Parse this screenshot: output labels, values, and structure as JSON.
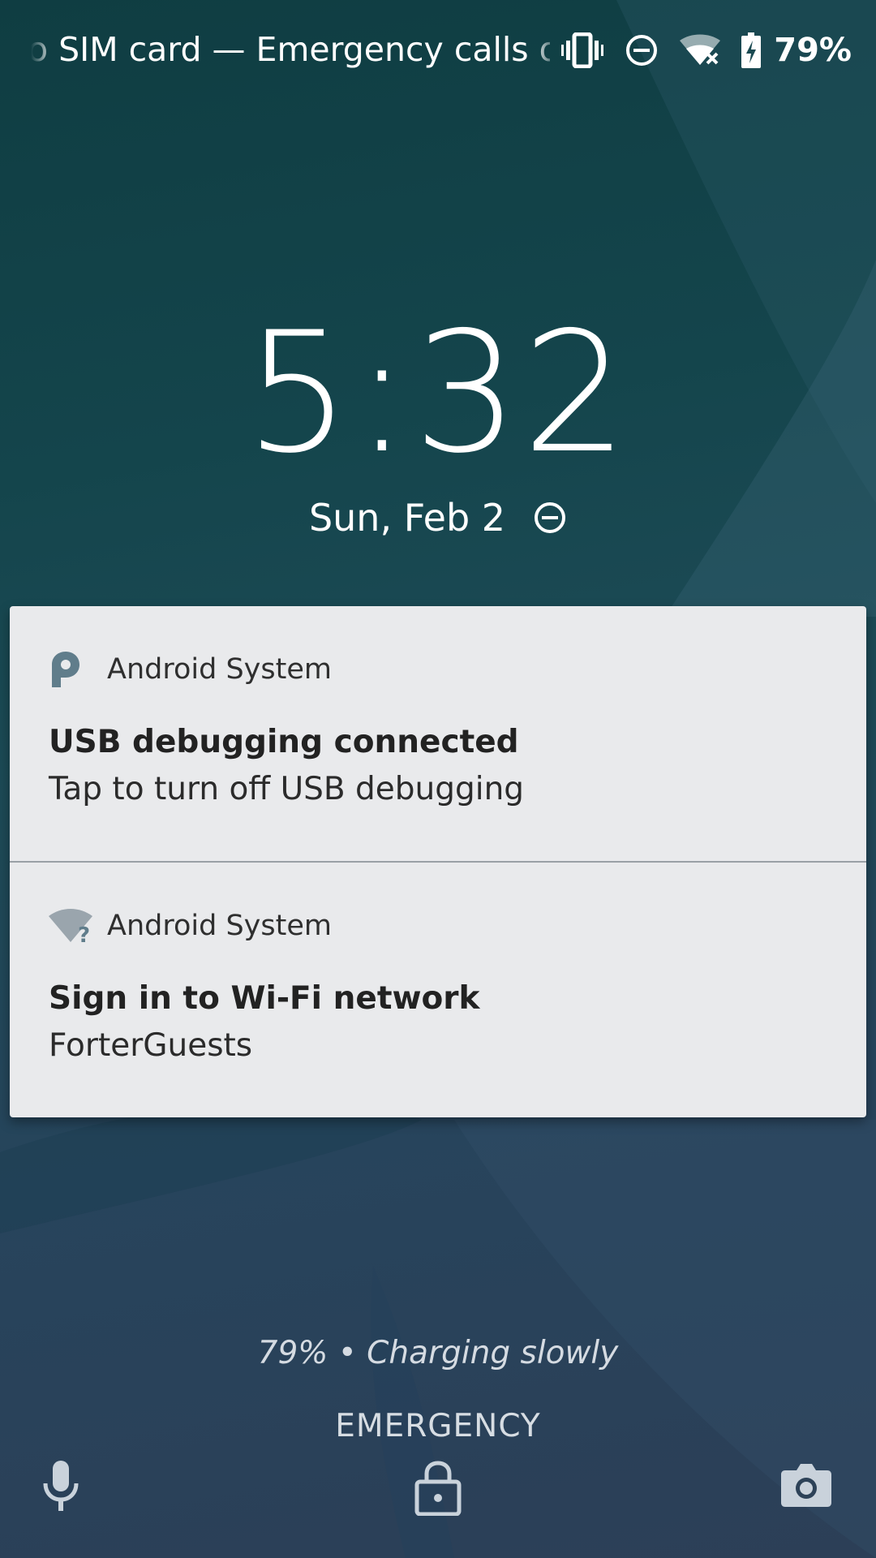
{
  "status_bar": {
    "carrier_text": "o SIM card — Emergency calls only",
    "icons": [
      "vibrate-icon",
      "do-not-disturb-icon",
      "wifi-off-icon",
      "battery-charging-icon"
    ],
    "battery_percent": "79%"
  },
  "lockscreen": {
    "time": "5:32",
    "date": "Sun, Feb 2",
    "date_icon": "do-not-disturb-icon"
  },
  "notifications": [
    {
      "app_name": "Android System",
      "icon": "android-p-icon",
      "title": "USB debugging connected",
      "text": "Tap to turn off USB debugging"
    },
    {
      "app_name": "Android System",
      "icon": "wifi-question-icon",
      "title": "Sign in to Wi-Fi network",
      "text": "ForterGuests"
    }
  ],
  "footer": {
    "charging_text": "79% • Charging slowly",
    "emergency_label": "EMERGENCY",
    "icons": [
      "microphone-icon",
      "lock-icon",
      "camera-icon"
    ]
  },
  "colors": {
    "background_top": "#0f3d42",
    "background_bottom": "#2c3f57",
    "notification_bg": "#e9eaec",
    "app_icon_gray": "#607d8b"
  }
}
